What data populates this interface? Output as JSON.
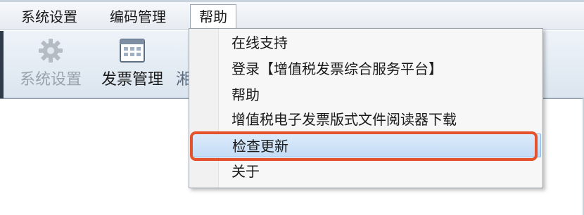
{
  "menubar": {
    "items": [
      {
        "label": "系统设置"
      },
      {
        "label": "编码管理"
      },
      {
        "label": "帮助"
      }
    ]
  },
  "toolbar": {
    "buttons": [
      {
        "label": "系统设置",
        "icon": "gear-icon",
        "state": "disabled"
      },
      {
        "label": "发票管理",
        "icon": "invoice-grid-icon",
        "state": "enabled"
      },
      {
        "label": "湘",
        "icon": "",
        "state": "partially-visible"
      }
    ]
  },
  "help_menu": {
    "items": [
      {
        "label": "在线支持"
      },
      {
        "label": "登录【增值税发票综合服务平台】"
      },
      {
        "label": "帮助"
      },
      {
        "label": "增值税电子发票版式文件阅读器下载"
      },
      {
        "label": "检查更新",
        "highlighted": true
      },
      {
        "label": "关于"
      }
    ]
  },
  "colors": {
    "highlight_bg": "#c4dcf5",
    "annotation_border": "#e5532c",
    "menu_bg": "#f7f7f7"
  }
}
